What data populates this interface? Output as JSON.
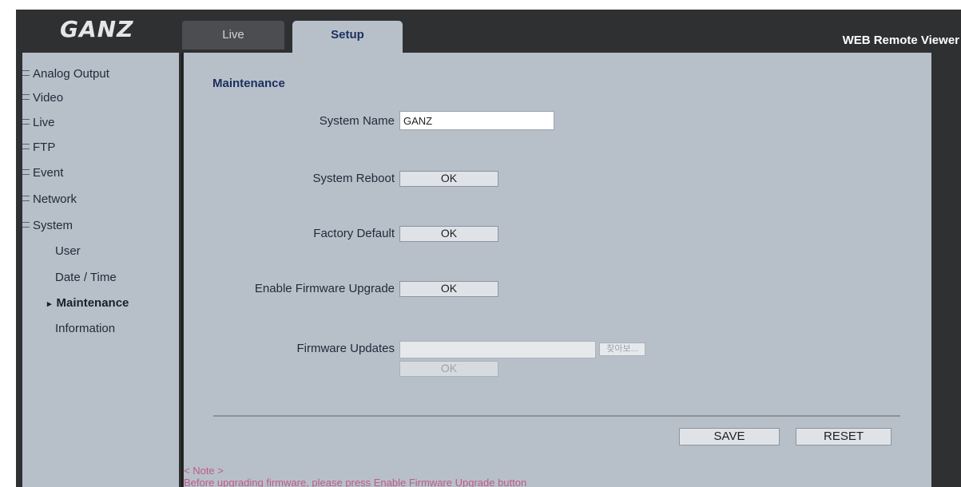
{
  "header": {
    "logo": "GANZ",
    "tabs": [
      {
        "label": "Live"
      },
      {
        "label": "Setup"
      }
    ],
    "app_title": "WEB Remote Viewer"
  },
  "sidebar": {
    "items": [
      {
        "label": "Analog Output"
      },
      {
        "label": "Video"
      },
      {
        "label": "Live"
      },
      {
        "label": "FTP"
      },
      {
        "label": "Event"
      },
      {
        "label": "Network"
      },
      {
        "label": "System"
      }
    ],
    "system_subitems": [
      {
        "label": "User"
      },
      {
        "label": "Date / Time"
      },
      {
        "label": "Maintenance"
      },
      {
        "label": "Information"
      }
    ],
    "active_subitem": "Maintenance"
  },
  "main": {
    "section_title": "Maintenance",
    "system_name": {
      "label": "System Name",
      "value": "GANZ"
    },
    "system_reboot": {
      "label": "System Reboot",
      "button": "OK"
    },
    "factory_default": {
      "label": "Factory Default",
      "button": "OK"
    },
    "enable_firmware_upgrade": {
      "label": "Enable Firmware Upgrade",
      "button": "OK"
    },
    "firmware_updates": {
      "label": "Firmware Updates",
      "browse_button": "찾아보...",
      "button": "OK"
    },
    "save_button": "SAVE",
    "reset_button": "RESET",
    "note_title": "< Note >",
    "note_text": "Before upgrading firmware, please press Enable Firmware Upgrade button"
  },
  "colors": {
    "frame": "#2f3032",
    "panel": "#b7c0c9",
    "accent_text": "#1c2f5e",
    "note_text": "#c05a8a"
  }
}
